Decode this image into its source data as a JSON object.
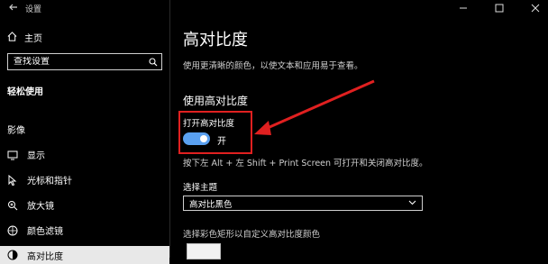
{
  "window": {
    "title": "设置"
  },
  "sidebar": {
    "home_label": "主页",
    "search_placeholder": "查找设置",
    "section_heading": "轻松使用",
    "group_label": "影像",
    "items": [
      {
        "label": "显示",
        "icon": "display-icon"
      },
      {
        "label": "光标和指针",
        "icon": "cursor-icon"
      },
      {
        "label": "放大镜",
        "icon": "magnifier-icon"
      },
      {
        "label": "颜色滤镜",
        "icon": "color-filter-icon"
      },
      {
        "label": "高对比度",
        "icon": "high-contrast-icon",
        "selected": true
      }
    ]
  },
  "main": {
    "title": "高对比度",
    "description": "使用更清晰的颜色，以使文本和应用易于查看。",
    "subheading": "使用高对比度",
    "toggle_label": "打开高对比度",
    "toggle_state": "开",
    "toggle_on": true,
    "shortcut_text": "按下左 Alt + 左 Shift + Print Screen 可打开和关闭高对比度。",
    "theme_label": "选择主题",
    "theme_value": "高对比黑色",
    "color_prompt": "选择彩色矩形以自定义高对比度颜色"
  },
  "colors": {
    "accent": "#5aa0f0",
    "annotation": "#e02020"
  }
}
